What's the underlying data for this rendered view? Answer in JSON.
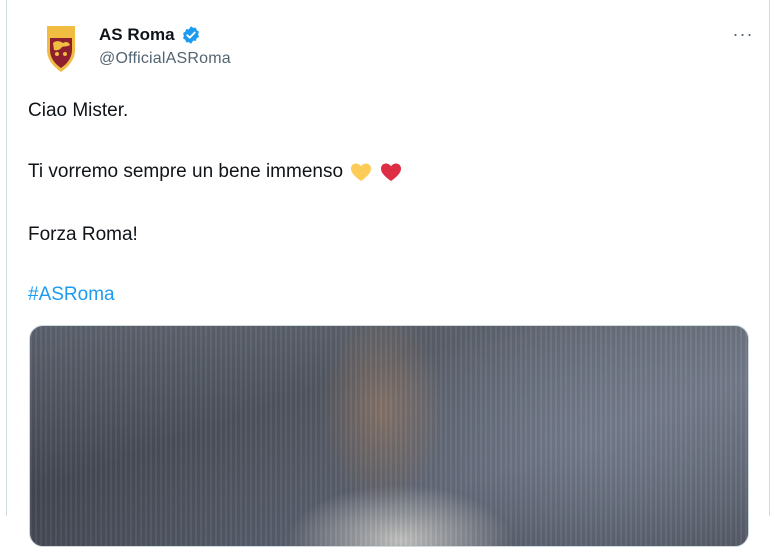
{
  "tweet": {
    "author": {
      "display_name": "AS Roma",
      "handle": "@OfficialASRoma",
      "verified": true,
      "avatar_icon": "as-roma-crest-icon"
    },
    "more_label": "···",
    "lines": {
      "line1": "Ciao Mister.",
      "line2": "Ti vorremo sempre un bene immenso",
      "line3": "Forza Roma!"
    },
    "emojis": [
      "yellow-heart-icon",
      "red-heart-icon"
    ],
    "hashtag": "#ASRoma",
    "media": {
      "kind": "photo"
    }
  },
  "colors": {
    "text": "#0f1419",
    "secondary": "#536471",
    "link": "#1d9bf0",
    "verified": "#1d9bf0",
    "roma_maroon": "#8e1f2f",
    "roma_gold": "#f0bc42"
  }
}
